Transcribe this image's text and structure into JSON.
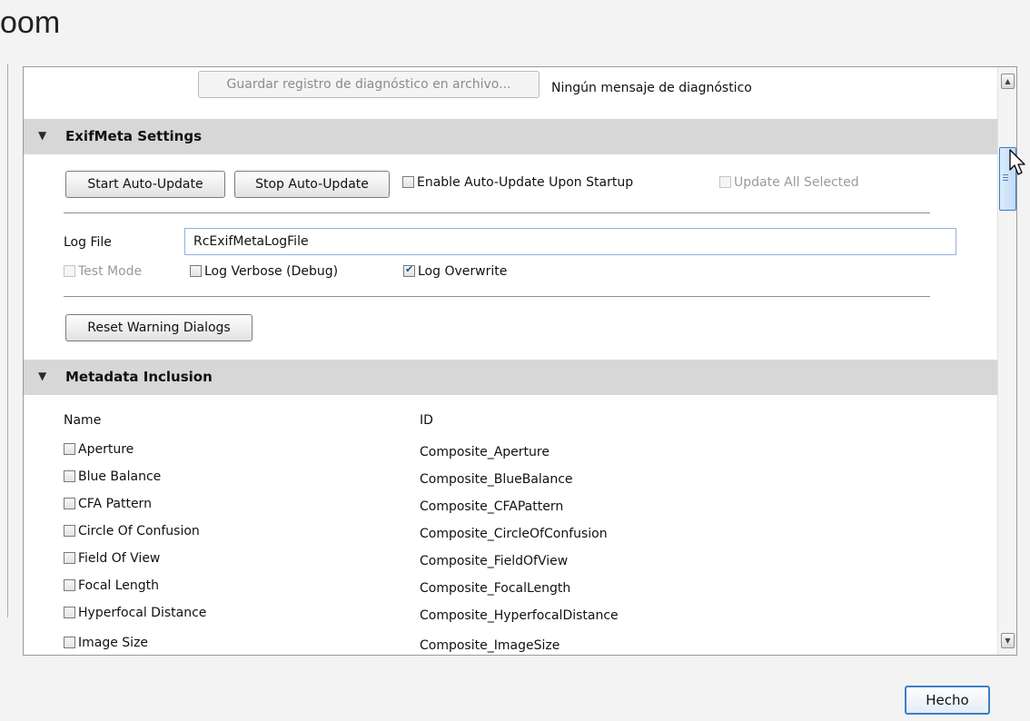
{
  "app_title_fragment": "oom",
  "diagnostics": {
    "save_log_button": "Guardar registro de diagnóstico en archivo...",
    "status_text": "Ningún mensaje de diagnóstico"
  },
  "exifmeta": {
    "section_title": "ExifMeta Settings",
    "start_button": "Start Auto-Update",
    "stop_button": "Stop Auto-Update",
    "enable_on_startup": {
      "label": "Enable Auto-Update Upon Startup",
      "checked": false
    },
    "update_all_selected": {
      "label": "Update All Selected",
      "checked": false,
      "enabled": false
    },
    "log_file_label": "Log File",
    "log_file_value": "RcExifMetaLogFile",
    "test_mode": {
      "label": "Test Mode",
      "checked": false,
      "enabled": false
    },
    "log_verbose": {
      "label": "Log Verbose (Debug)",
      "checked": false
    },
    "log_overwrite": {
      "label": "Log Overwrite",
      "checked": true
    },
    "reset_button": "Reset Warning Dialogs"
  },
  "metadata": {
    "section_title": "Metadata Inclusion",
    "columns": {
      "name": "Name",
      "id": "ID"
    },
    "rows": [
      {
        "name": "Aperture",
        "id": "Composite_Aperture",
        "checked": false
      },
      {
        "name": "Blue Balance",
        "id": "Composite_BlueBalance",
        "checked": false
      },
      {
        "name": "CFA Pattern",
        "id": "Composite_CFAPattern",
        "checked": false
      },
      {
        "name": "Circle Of Confusion",
        "id": "Composite_CircleOfConfusion",
        "checked": false
      },
      {
        "name": "Field Of View",
        "id": "Composite_FieldOfView",
        "checked": false
      },
      {
        "name": "Focal Length",
        "id": "Composite_FocalLength",
        "checked": false
      },
      {
        "name": "Hyperfocal Distance",
        "id": "Composite_HyperfocalDistance",
        "checked": false
      },
      {
        "name": "Image Size",
        "id": "Composite_ImageSize",
        "checked": false
      }
    ]
  },
  "done_button": "Hecho",
  "icons": {
    "section_expanded": "triangle-down-icon",
    "scroll_up": "arrow-up-icon",
    "scroll_down": "arrow-down-icon",
    "cursor": "mouse-pointer-icon",
    "checkmark": "checkmark-icon"
  }
}
